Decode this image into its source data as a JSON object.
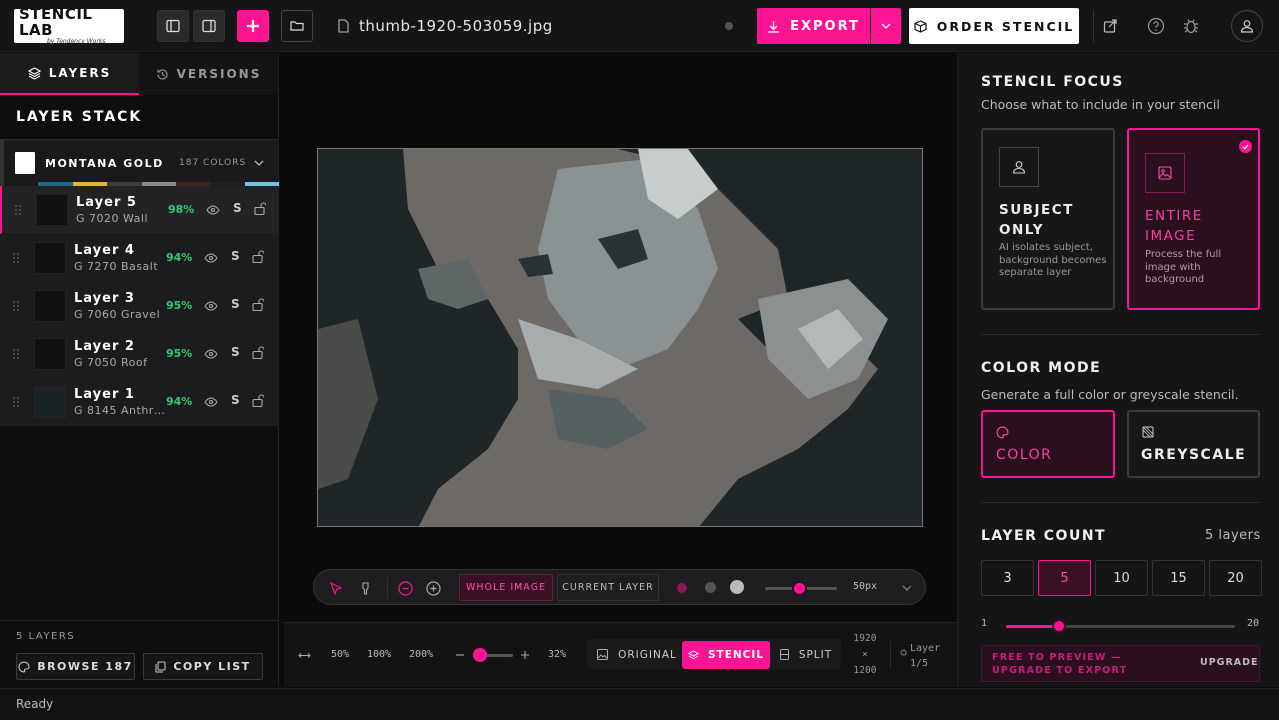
{
  "app": {
    "logo": "STENCIL LAB",
    "logo_sub": "by Tendency Works",
    "filename": "thumb-1920-503059.jpg"
  },
  "toolbar": {
    "export_label": "EXPORT",
    "order_label": "ORDER STENCIL"
  },
  "left": {
    "tabs": [
      {
        "label": "LAYERS"
      },
      {
        "label": "VERSIONS"
      }
    ],
    "stack_title": "LAYER STACK",
    "brand": {
      "name": "MONTANA GOLD",
      "count": "187 COLORS"
    },
    "swatches": [
      "#1a1a1a",
      "#1b6b85",
      "#e2b526",
      "#3d3d3d",
      "#8a8a8a",
      "#3b2426",
      "#202020",
      "#6ec3e6"
    ],
    "layers": [
      {
        "name": "Layer 5",
        "sub": "G 7020 Wall",
        "pct": "98%"
      },
      {
        "name": "Layer 4",
        "sub": "G 7270 Basalt",
        "pct": "94%"
      },
      {
        "name": "Layer 3",
        "sub": "G 7060 Gravel",
        "pct": "95%"
      },
      {
        "name": "Layer 2",
        "sub": "G 7050 Roof",
        "pct": "95%"
      },
      {
        "name": "Layer 1",
        "sub": "G 8145 Anthr…",
        "pct": "94%"
      }
    ],
    "layer_count_label": "5 LAYERS",
    "browse_label": "BROWSE 187",
    "copy_label": "COPY LIST"
  },
  "canvas": {
    "tools": {
      "whole_image": "WHOLE IMAGE",
      "current_layer": "CURRENT LAYER",
      "brush_size": "50px"
    },
    "zoom": {
      "z50": "50%",
      "z100": "100%",
      "z200": "200%",
      "current": "32%"
    },
    "views": {
      "original": "ORIGINAL",
      "stencil": "STENCIL",
      "split": "SPLIT"
    },
    "dims": {
      "w": "1920",
      "x": "×",
      "h": "1200"
    },
    "layer_info": {
      "label": "Layer",
      "value": "1/5"
    }
  },
  "right": {
    "focus_title": "STENCIL FOCUS",
    "focus_sub": "Choose what to include in your stencil",
    "subject_title": "SUBJECT ONLY",
    "subject_desc": "AI isolates subject, background becomes separate layer",
    "entire_title": "ENTIRE IMAGE",
    "entire_desc": "Process the full image with background",
    "mode_title": "COLOR MODE",
    "mode_sub": "Generate a full color or greyscale stencil.",
    "color_label": "COLOR",
    "grey_label": "GREYSCALE",
    "count_title": "LAYER COUNT",
    "count_value": "5 layers",
    "counts": [
      "3",
      "5",
      "10",
      "15",
      "20"
    ],
    "slider_min": "1",
    "slider_max": "20",
    "slider_value": 5,
    "banner_text": "FREE TO PREVIEW — UPGRADE TO EXPORT",
    "upgrade_label": "UPGRADE"
  },
  "status": {
    "text": "Ready"
  },
  "colors": {
    "accent": "#ff1493",
    "good": "#2ecc71"
  }
}
